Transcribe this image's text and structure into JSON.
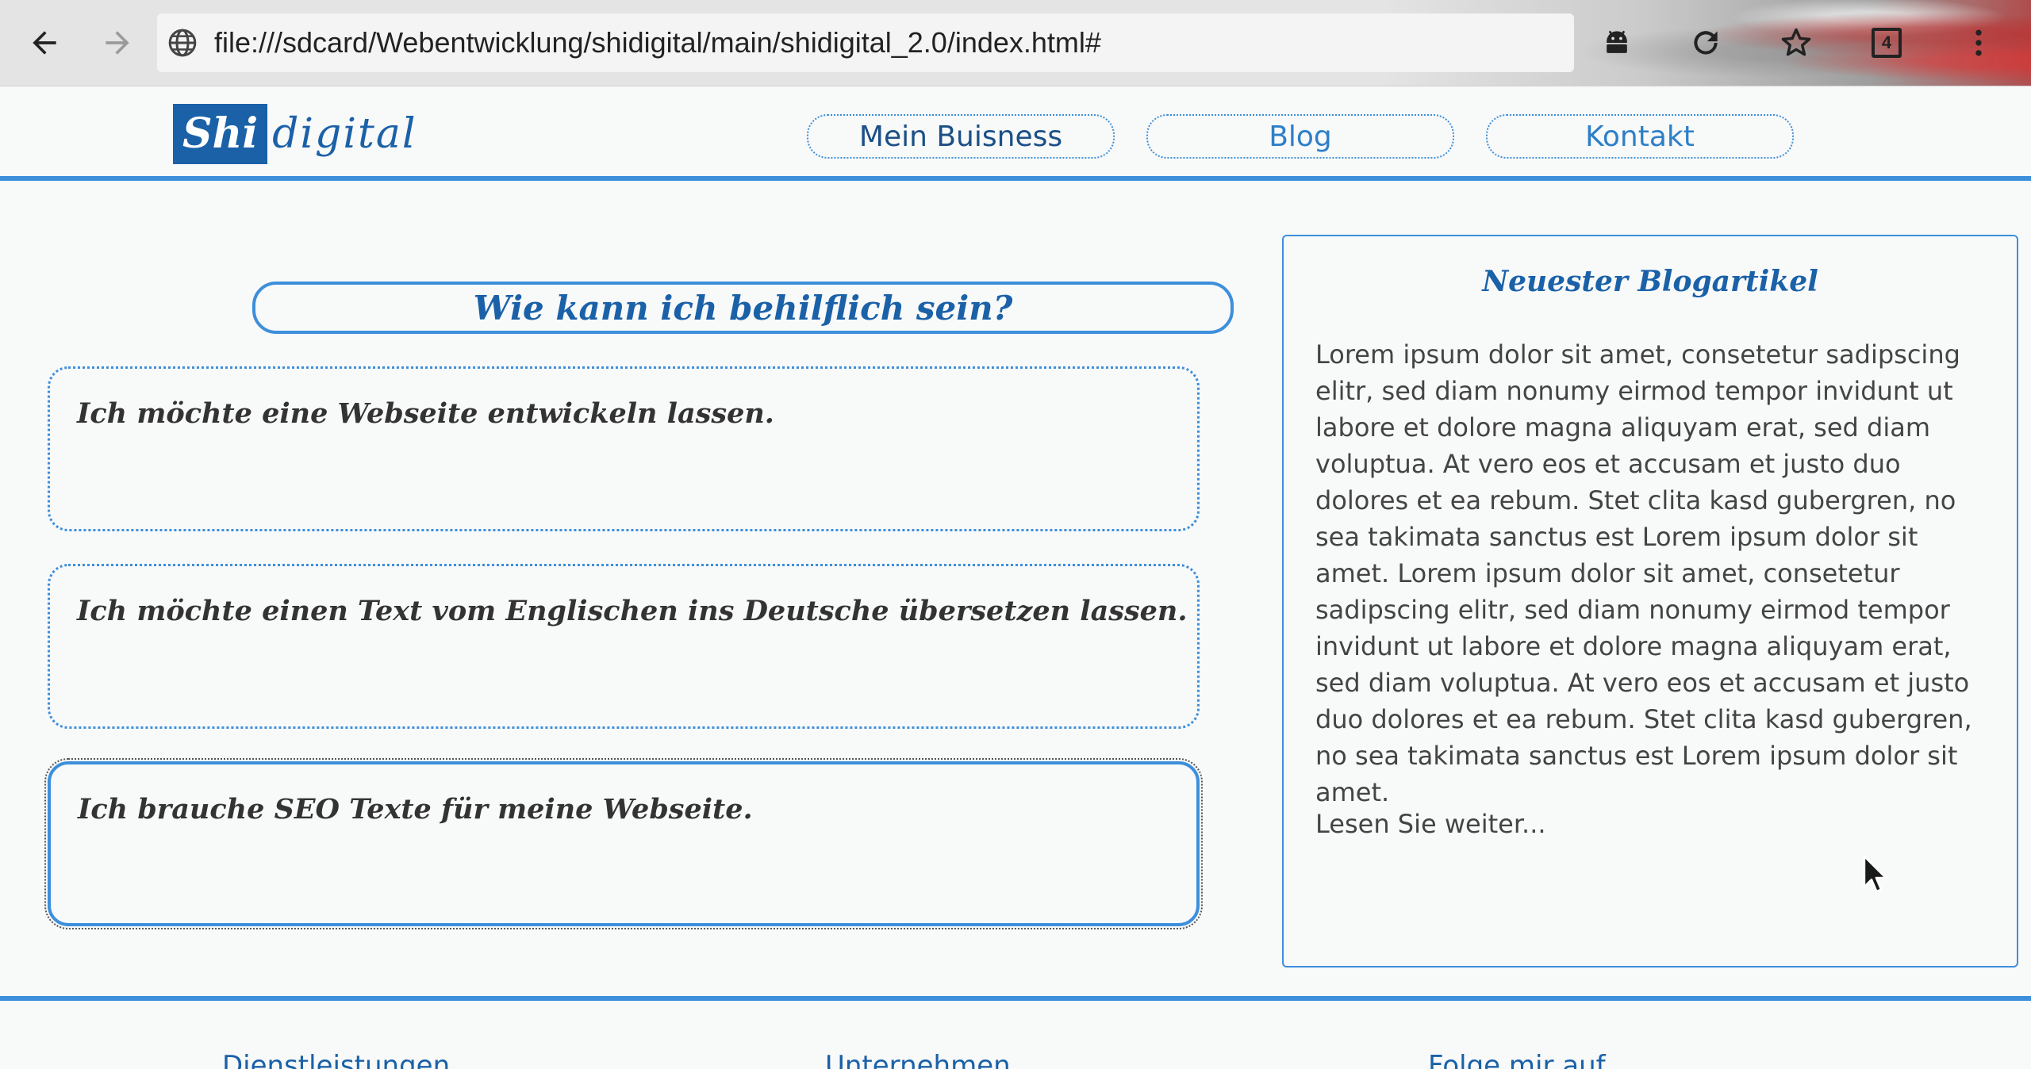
{
  "browser": {
    "url": "file:///sdcard/Webentwicklung/shidigital/main/shidigital_2.0/index.html#",
    "tab_count": "4",
    "icons": {
      "back": "arrow-left-icon",
      "forward": "arrow-right-icon",
      "site": "globe-icon",
      "android": "android-icon",
      "reload": "reload-icon",
      "bookmark": "star-icon",
      "tabs": "tabs-icon",
      "menu": "more-vert-icon"
    }
  },
  "site": {
    "logo": {
      "highlight": "Shi",
      "rest": "digital"
    },
    "nav": [
      {
        "label": "Mein Buisness"
      },
      {
        "label": "Blog"
      },
      {
        "label": "Kontakt"
      }
    ]
  },
  "main": {
    "heading": "Wie kann ich behilflich sein?",
    "options": [
      {
        "label": "Ich möchte eine Webseite entwickeln lassen."
      },
      {
        "label": "Ich möchte einen Text vom Englischen ins Deutsche übersetzen lassen."
      },
      {
        "label": "Ich brauche SEO Texte für meine Webseite."
      }
    ]
  },
  "blog": {
    "title": "Neuester Blogartikel",
    "text": "Lorem ipsum dolor sit amet, consetetur sadipscing elitr, sed diam nonumy eirmod tempor invidunt ut labore et dolore magna aliquyam erat, sed diam voluptua. At vero eos et accusam et justo duo dolores et ea rebum. Stet clita kasd gubergren, no sea takimata sanctus est Lorem ipsum dolor sit amet. Lorem ipsum dolor sit amet, consetetur sadipscing elitr, sed diam nonumy eirmod tempor invidunt ut labore et dolore magna aliquyam erat, sed diam voluptua. At vero eos et accusam et justo duo dolores et ea rebum. Stet clita kasd gubergren, no sea takimata sanctus est Lorem ipsum dolor sit amet.",
    "more_link": "Lesen Sie weiter..."
  },
  "footer": {
    "headings": [
      "Dienstleistungen",
      "Unternehmen",
      "Folge mir auf"
    ]
  },
  "colors": {
    "accent": "#3d8fdb",
    "brand": "#1a61a8",
    "background": "#f8f9f9"
  }
}
